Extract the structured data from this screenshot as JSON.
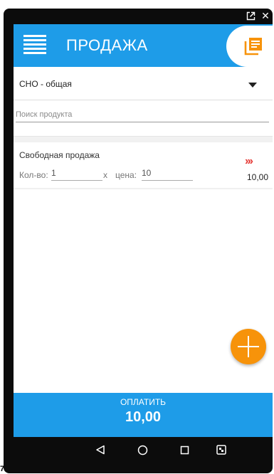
{
  "app": {
    "title": "ПРОДАЖА",
    "accent_color": "#1e9ce8",
    "fab_color": "#f7930a",
    "arrow_color": "#e53935"
  },
  "window_controls": {
    "external_icon": "external-link-icon",
    "close_icon": "close-icon",
    "close_glyph": "✕"
  },
  "toolbar": {
    "menu_icon": "hamburger-menu-icon",
    "docs_icon": "documents-icon"
  },
  "tax_select": {
    "selected": "СНО - общая"
  },
  "search": {
    "value": "",
    "placeholder": "Поиск продукта"
  },
  "items": [
    {
      "name": "Свободная продажа",
      "qty_label": "Кол-во:",
      "qty": "1",
      "times": "x",
      "price_label": "цена:",
      "price": "10",
      "arrows": "›››",
      "sum": "10,00"
    }
  ],
  "pay": {
    "label": "ОПЛАТИТЬ",
    "total": "10,00"
  },
  "navbar": {
    "back_icon": "back-triangle-icon",
    "home_icon": "home-circle-icon",
    "recents_icon": "recents-square-icon",
    "screenshot_icon": "screenshot-icon"
  },
  "corner_mark": "7"
}
